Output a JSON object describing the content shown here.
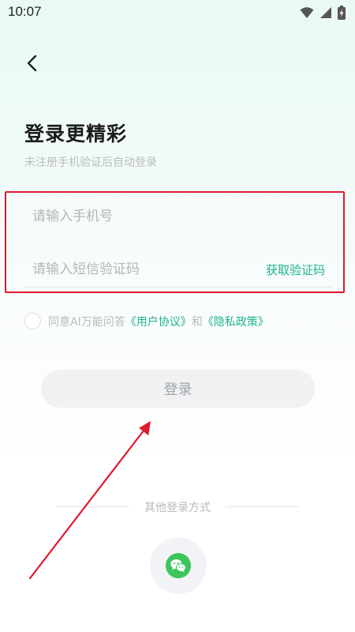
{
  "status_bar": {
    "time": "10:07",
    "icons": [
      "wifi-icon",
      "signal-icon",
      "battery-charging-icon"
    ]
  },
  "header": {
    "back_icon": "chevron-left-icon"
  },
  "login": {
    "title": "登录更精彩",
    "subtitle": "未注册手机验证后自动登录",
    "phone": {
      "value": "",
      "placeholder": "请输入手机号"
    },
    "code": {
      "value": "",
      "placeholder": "请输入短信验证码"
    },
    "get_code_label": "获取验证码",
    "agreement": {
      "checked": false,
      "prefix": "同意AI万能问答",
      "user_agreement": "《用户协议》",
      "and": "和",
      "privacy_policy": "《隐私政策》"
    },
    "login_button": "登录",
    "other_methods_label": "其他登录方式",
    "other_methods": [
      "wechat-icon"
    ]
  },
  "annotations": {
    "highlight_color": "#e0182c",
    "arrow_color": "#e0182c"
  },
  "colors": {
    "accent": "#1fb28e",
    "wechat": "#3bc55b"
  }
}
